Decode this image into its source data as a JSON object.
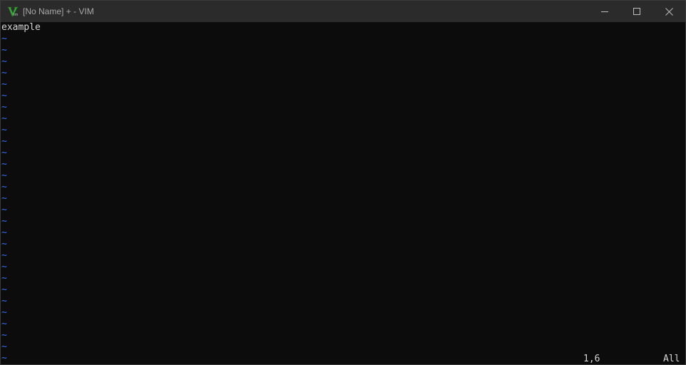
{
  "window": {
    "title": "[No Name] + - VIM",
    "icon": "vim-logo-icon",
    "controls": [
      "minimize-icon",
      "maximize-icon",
      "close-icon"
    ]
  },
  "editor": {
    "lines": [
      "example"
    ],
    "empty_line_marker": "~",
    "empty_line_count": 29
  },
  "statusline": {
    "cursor_position": "1,6",
    "scroll_position": "All"
  },
  "colors": {
    "background": "#0c0c0c",
    "titlebar": "#2b2b2b",
    "text": "#d6d6d6",
    "tilde": "#3b6ee8",
    "vim_green": "#3fa33f"
  }
}
